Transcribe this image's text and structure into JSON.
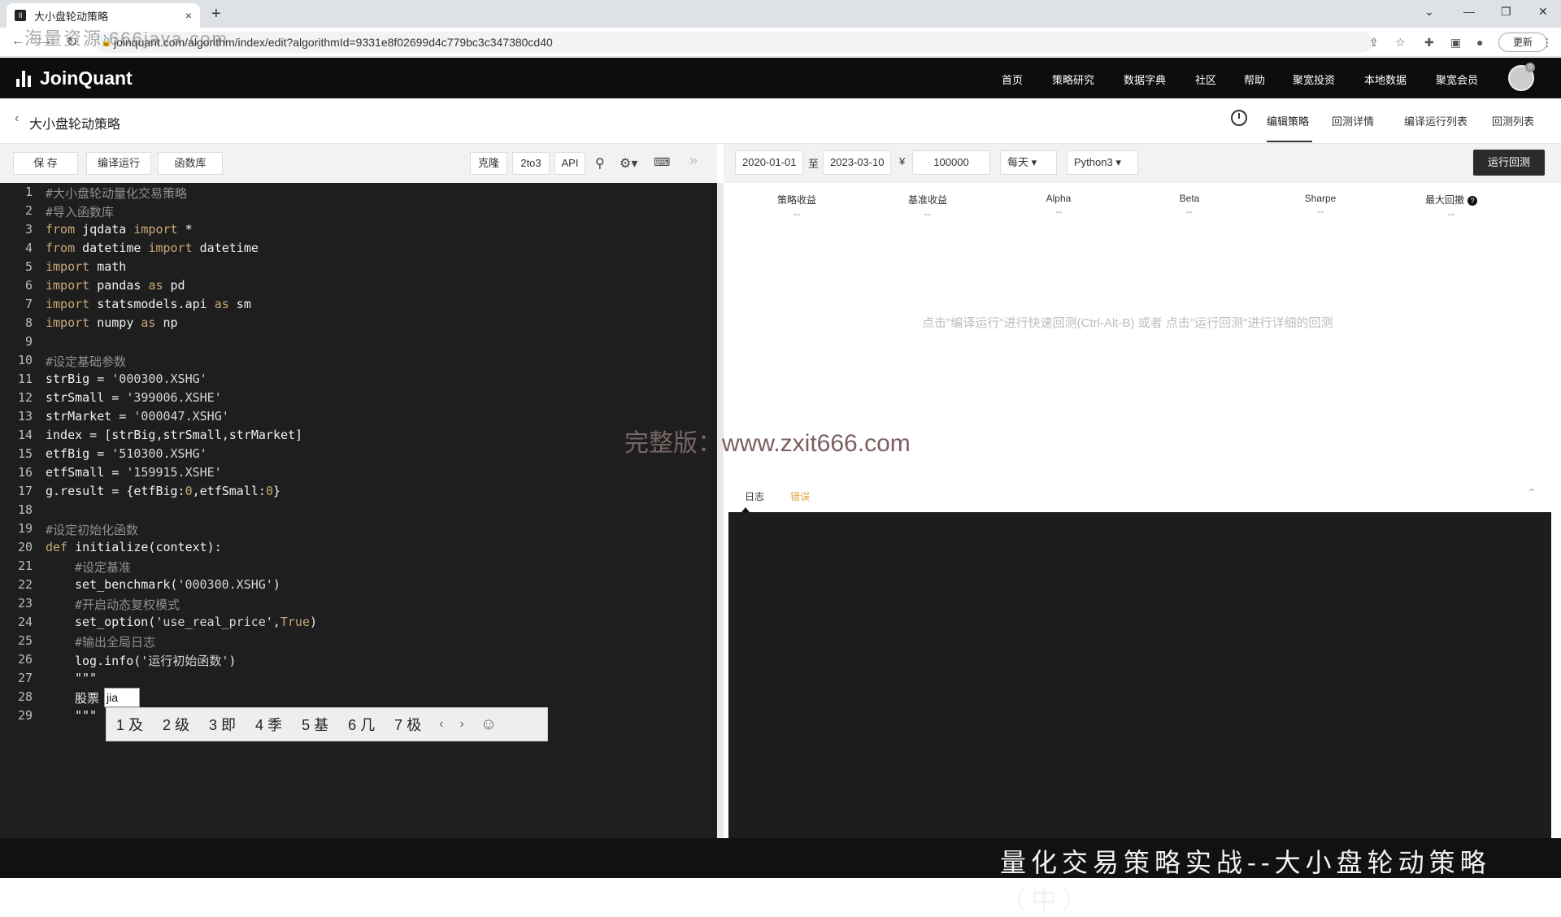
{
  "browser": {
    "tab_title": "大小盘轮动策略",
    "tab_close": "×",
    "new_tab": "+",
    "url": "joinquant.com/algorithm/index/edit?algorithmId=9331e8f02699d4c779bc3c347380cd40",
    "update_label": "更新",
    "watermark": "海量资源:666java.com"
  },
  "header": {
    "logo_text": "JoinQuant",
    "nav": [
      "首页",
      "策略研究",
      "数据字典",
      "社区",
      "帮助",
      "聚宽投资",
      "本地数据",
      "聚宽会员"
    ],
    "badge": "0"
  },
  "subheader": {
    "back": "‹",
    "title": "大小盘轮动策略",
    "tabs": [
      "编辑策略",
      "回测详情",
      "编译运行列表",
      "回测列表"
    ]
  },
  "toolbar": {
    "save": "保 存",
    "compile_run": "编译运行",
    "library": "函数库",
    "clone": "克隆",
    "to3": "2to3",
    "api": "API",
    "collapse": "»"
  },
  "backtest": {
    "start_date": "2020-01-01",
    "to": "至",
    "end_date": "2023-03-10",
    "currency": "¥",
    "capital": "100000",
    "frequency": "每天",
    "python": "Python3",
    "run_label": "运行回测"
  },
  "metrics": [
    {
      "label": "策略收益",
      "value": "--"
    },
    {
      "label": "基准收益",
      "value": "--"
    },
    {
      "label": "Alpha",
      "value": "--"
    },
    {
      "label": "Beta",
      "value": "--"
    },
    {
      "label": "Sharpe",
      "value": "--"
    },
    {
      "label": "最大回撤",
      "value": "--"
    }
  ],
  "hint": "点击\"编译运行\"进行快速回测(Ctrl-Alt-B) 或者 点击\"运行回测\"进行详细的回测",
  "promo": {
    "prefix": "完整版：",
    "url": "www.zxit666.com"
  },
  "log": {
    "tabs": [
      "日志",
      "错误"
    ]
  },
  "ime": {
    "input": "jia",
    "candidates": [
      "1 及",
      "2 级",
      "3 即",
      "4 季",
      "5 基",
      "6 几",
      "7 极"
    ],
    "emoji": "☺"
  },
  "caption": "量化交易策略实战--大小盘轮动策略（中）",
  "code": {
    "line_numbers": [
      "1",
      "2",
      "3",
      "4",
      "5",
      "6",
      "7",
      "8",
      "9",
      "10",
      "11",
      "12",
      "13",
      "14",
      "15",
      "16",
      "17",
      "18",
      "19",
      "20",
      "21",
      "22",
      "23",
      "24",
      "25",
      "26",
      "27",
      "28",
      "29"
    ],
    "l1": "#大小盘轮动量化交易策略",
    "l2": "#导入函数库",
    "l3a": "from",
    "l3b": " jqdata ",
    "l3c": "import",
    "l3d": " *",
    "l4a": "from",
    "l4b": " datetime ",
    "l4c": "import",
    "l4d": " datetime",
    "l5a": "import",
    "l5b": " math",
    "l6a": "import",
    "l6b": " pandas ",
    "l6c": "as",
    "l6d": " pd",
    "l7a": "import",
    "l7b": " statsmodels.api ",
    "l7c": "as",
    "l7d": " sm",
    "l8a": "import",
    "l8b": " numpy ",
    "l8c": "as",
    "l8d": " np",
    "l10": "#设定基础参数",
    "l11a": "strBig = ",
    "l11b": "'000300.XSHG'",
    "l12a": "strSmall = ",
    "l12b": "'399006.XSHE'",
    "l13a": "strMarket = ",
    "l13b": "'000047.XSHG'",
    "l14": "index = [strBig,strSmall,strMarket]",
    "l15a": "etfBig = ",
    "l15b": "'510300.XSHG'",
    "l16a": "etfSmall = ",
    "l16b": "'159915.XSHE'",
    "l17a": "g.result = {etfBig:",
    "l17b": "0",
    "l17c": ",etfSmall:",
    "l17d": "0",
    "l17e": "}",
    "l19": "#设定初始化函数",
    "l20a": "def",
    "l20b": " initialize(context):",
    "l21": "#设定基准",
    "l22a": "set_benchmark(",
    "l22b": "'000300.XSHG'",
    "l22c": ")",
    "l23": "#开启动态复权模式",
    "l24a": "set_option(",
    "l24b": "'use_real_price'",
    "l24c": ",",
    "l24d": "True",
    "l24e": ")",
    "l25": "#输出全局日志",
    "l26a": "log.info(",
    "l26b": "'运行初始函数'",
    "l26c": ")",
    "l27": "\"\"\"",
    "l28": "股票",
    "l29": "\"\"\""
  }
}
